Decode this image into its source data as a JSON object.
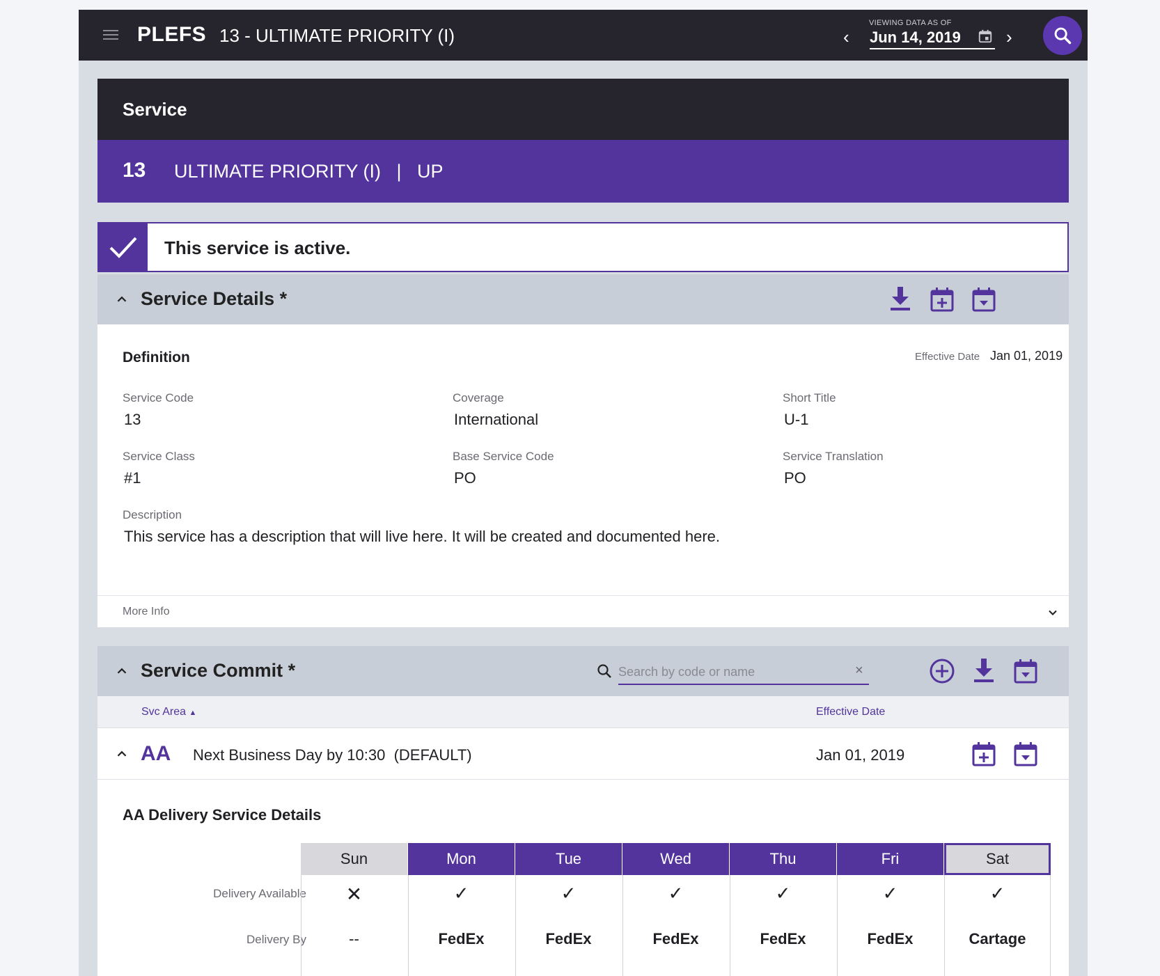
{
  "app": {
    "name": "PLEFS",
    "context": "13 - ULTIMATE PRIORITY (I)"
  },
  "date_nav": {
    "label": "VIEWING DATA AS OF",
    "date": "Jun 14, 2019"
  },
  "service": {
    "header": "Service",
    "code": "13",
    "name": "ULTIMATE PRIORITY (I)   |   UP"
  },
  "status": {
    "message": "This service is active."
  },
  "details": {
    "title": "Service Details *",
    "section": "Definition",
    "effective_label": "Effective Date",
    "effective_date": "Jan 01, 2019",
    "fields": {
      "service_code": {
        "label": "Service Code",
        "value": "13"
      },
      "coverage": {
        "label": "Coverage",
        "value": "International"
      },
      "short_title": {
        "label": "Short Title",
        "value": "U-1"
      },
      "service_class": {
        "label": "Service Class",
        "value": "#1"
      },
      "base_service_code": {
        "label": "Base Service Code",
        "value": "PO"
      },
      "service_translation": {
        "label": "Service Translation",
        "value": "PO"
      },
      "description": {
        "label": "Description",
        "value": "This service has a description that will live here. It will be created and documented here."
      }
    },
    "more_info": "More Info"
  },
  "commit": {
    "title": "Service Commit *",
    "search_placeholder": "Search by code or name",
    "clear": "×",
    "columns": {
      "svc_area": "Svc Area",
      "effective_date": "Effective Date"
    },
    "row": {
      "code": "AA",
      "description": "Next Business Day by 10:30  (DEFAULT)",
      "date": "Jan 01, 2019"
    }
  },
  "delivery": {
    "title": "AA Delivery Service Details",
    "row_labels": {
      "available": "Delivery Available",
      "by": "Delivery By"
    },
    "days": [
      {
        "name": "Sun",
        "available": "✕",
        "by": "--"
      },
      {
        "name": "Mon",
        "available": "✓",
        "by": "FedEx"
      },
      {
        "name": "Tue",
        "available": "✓",
        "by": "FedEx"
      },
      {
        "name": "Wed",
        "available": "✓",
        "by": "FedEx"
      },
      {
        "name": "Thu",
        "available": "✓",
        "by": "FedEx"
      },
      {
        "name": "Fri",
        "available": "✓",
        "by": "FedEx"
      },
      {
        "name": "Sat",
        "available": "✓",
        "by": "Cartage"
      }
    ]
  },
  "colors": {
    "brand": "#53349c",
    "dark": "#26252d",
    "panel_header": "#c7ced8"
  }
}
